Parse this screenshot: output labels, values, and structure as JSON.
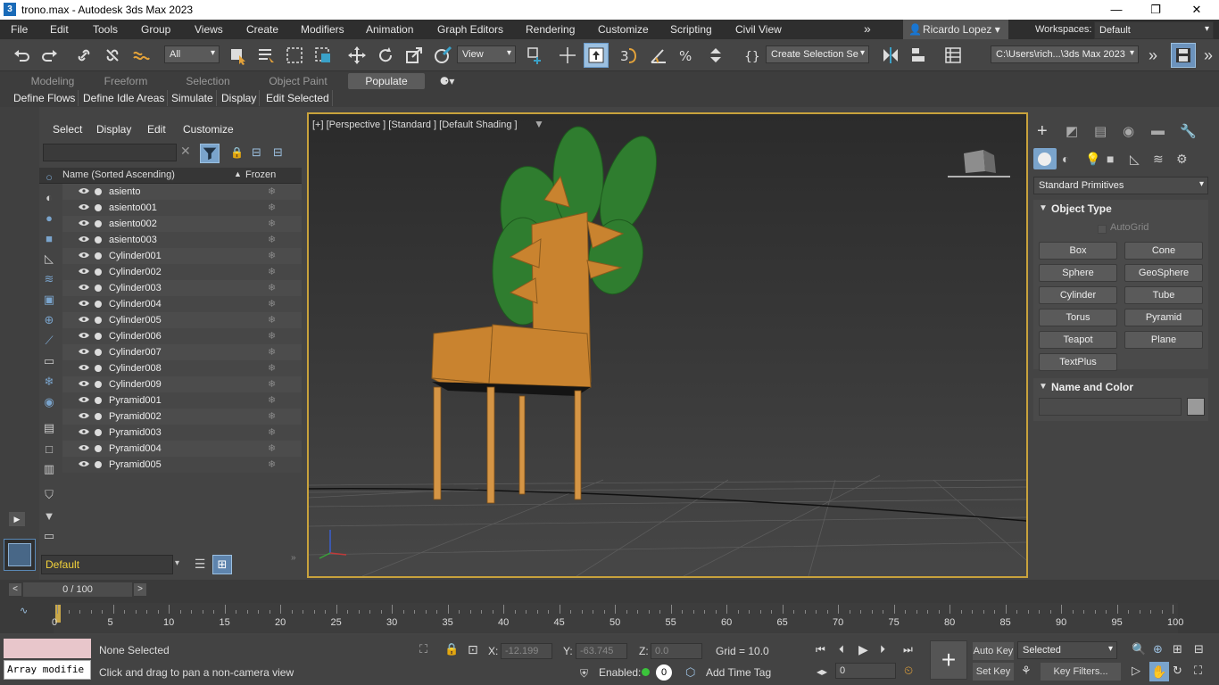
{
  "window": {
    "title": "trono.max - Autodesk 3ds Max 2023",
    "minimize": "—",
    "maximize": "❐",
    "close": "✕"
  },
  "menubar": {
    "items": [
      "File",
      "Edit",
      "Tools",
      "Group",
      "Views",
      "Create",
      "Modifiers",
      "Animation",
      "Graph Editors",
      "Rendering",
      "Customize",
      "Scripting",
      "Civil View"
    ],
    "user": "Ricardo Lopez ▾",
    "workspaces_label": "Workspaces:",
    "workspace": "Default"
  },
  "toolbar": {
    "filter": "All",
    "ref_coord": "View",
    "selection_set": "Create Selection Se",
    "project_path": "C:\\Users\\rich...\\3ds Max 2023"
  },
  "ribbon": {
    "tabs": [
      "Modeling",
      "Freeform",
      "Selection",
      "Object Paint",
      "Populate"
    ],
    "active_tab": "Populate",
    "buttons": [
      "Define Flows",
      "Define Idle Areas",
      "Simulate",
      "Display",
      "Edit Selected"
    ]
  },
  "scene_explorer": {
    "menu": [
      "Select",
      "Display",
      "Edit",
      "Customize"
    ],
    "col_name": "Name (Sorted Ascending)",
    "col_frozen": "Frozen",
    "objects": [
      "asiento",
      "asiento001",
      "asiento002",
      "asiento003",
      "Cylinder001",
      "Cylinder002",
      "Cylinder003",
      "Cylinder004",
      "Cylinder005",
      "Cylinder006",
      "Cylinder007",
      "Cylinder008",
      "Cylinder009",
      "Pyramid001",
      "Pyramid002",
      "Pyramid003",
      "Pyramid004",
      "Pyramid005"
    ],
    "layer": "Default"
  },
  "viewport": {
    "label": "[+] [Perspective ] [Standard ] [Default Shading ]"
  },
  "command_panel": {
    "category": "Standard Primitives",
    "object_type_title": "Object Type",
    "autogrid": "AutoGrid",
    "buttons": [
      "Box",
      "Cone",
      "Sphere",
      "GeoSphere",
      "Cylinder",
      "Tube",
      "Torus",
      "Pyramid",
      "Teapot",
      "Plane",
      "TextPlus"
    ],
    "name_color_title": "Name and Color",
    "object_color": "#9a9a9a"
  },
  "timeline": {
    "frame_display": "0 / 100",
    "ticks": [
      "0",
      "5",
      "10",
      "15",
      "20",
      "25",
      "30",
      "35",
      "40",
      "45",
      "50",
      "55",
      "60",
      "65",
      "70",
      "75",
      "80",
      "85",
      "90",
      "95",
      "100"
    ]
  },
  "status": {
    "maxscript": "Array modifie",
    "selection": "None Selected",
    "prompt": "Click and drag to pan a non-camera view",
    "x_label": "X:",
    "x": "-12.199",
    "y_label": "Y:",
    "y": "-63.745",
    "z_label": "Z:",
    "z": "0.0",
    "grid": "Grid = 10.0",
    "enabled_label": "Enabled:",
    "enabled_value": "0",
    "add_time_tag": "Add Time Tag",
    "auto_key": "Auto Key",
    "set_key": "Set Key",
    "key_mode": "Selected",
    "key_filters": "Key Filters...",
    "current_frame": "0"
  }
}
